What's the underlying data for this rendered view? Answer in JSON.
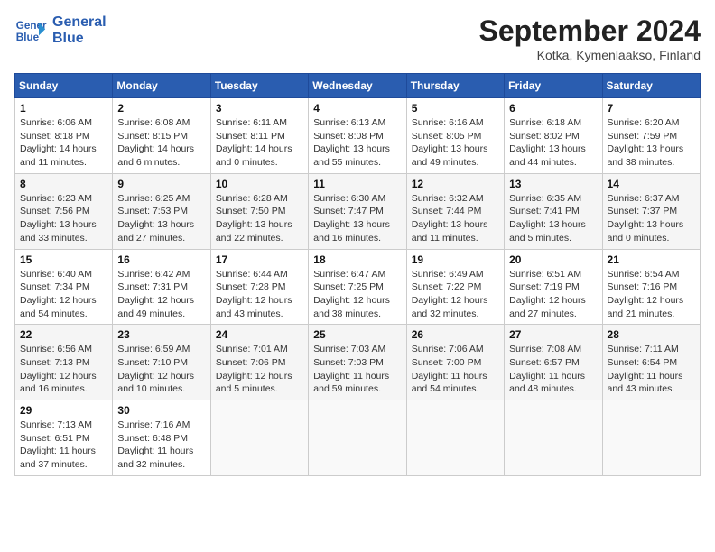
{
  "header": {
    "logo_line1": "General",
    "logo_line2": "Blue",
    "month_title": "September 2024",
    "location": "Kotka, Kymenlaakso, Finland"
  },
  "days_of_week": [
    "Sunday",
    "Monday",
    "Tuesday",
    "Wednesday",
    "Thursday",
    "Friday",
    "Saturday"
  ],
  "weeks": [
    [
      {
        "day": "1",
        "sunrise": "Sunrise: 6:06 AM",
        "sunset": "Sunset: 8:18 PM",
        "daylight": "Daylight: 14 hours and 11 minutes."
      },
      {
        "day": "2",
        "sunrise": "Sunrise: 6:08 AM",
        "sunset": "Sunset: 8:15 PM",
        "daylight": "Daylight: 14 hours and 6 minutes."
      },
      {
        "day": "3",
        "sunrise": "Sunrise: 6:11 AM",
        "sunset": "Sunset: 8:11 PM",
        "daylight": "Daylight: 14 hours and 0 minutes."
      },
      {
        "day": "4",
        "sunrise": "Sunrise: 6:13 AM",
        "sunset": "Sunset: 8:08 PM",
        "daylight": "Daylight: 13 hours and 55 minutes."
      },
      {
        "day": "5",
        "sunrise": "Sunrise: 6:16 AM",
        "sunset": "Sunset: 8:05 PM",
        "daylight": "Daylight: 13 hours and 49 minutes."
      },
      {
        "day": "6",
        "sunrise": "Sunrise: 6:18 AM",
        "sunset": "Sunset: 8:02 PM",
        "daylight": "Daylight: 13 hours and 44 minutes."
      },
      {
        "day": "7",
        "sunrise": "Sunrise: 6:20 AM",
        "sunset": "Sunset: 7:59 PM",
        "daylight": "Daylight: 13 hours and 38 minutes."
      }
    ],
    [
      {
        "day": "8",
        "sunrise": "Sunrise: 6:23 AM",
        "sunset": "Sunset: 7:56 PM",
        "daylight": "Daylight: 13 hours and 33 minutes."
      },
      {
        "day": "9",
        "sunrise": "Sunrise: 6:25 AM",
        "sunset": "Sunset: 7:53 PM",
        "daylight": "Daylight: 13 hours and 27 minutes."
      },
      {
        "day": "10",
        "sunrise": "Sunrise: 6:28 AM",
        "sunset": "Sunset: 7:50 PM",
        "daylight": "Daylight: 13 hours and 22 minutes."
      },
      {
        "day": "11",
        "sunrise": "Sunrise: 6:30 AM",
        "sunset": "Sunset: 7:47 PM",
        "daylight": "Daylight: 13 hours and 16 minutes."
      },
      {
        "day": "12",
        "sunrise": "Sunrise: 6:32 AM",
        "sunset": "Sunset: 7:44 PM",
        "daylight": "Daylight: 13 hours and 11 minutes."
      },
      {
        "day": "13",
        "sunrise": "Sunrise: 6:35 AM",
        "sunset": "Sunset: 7:41 PM",
        "daylight": "Daylight: 13 hours and 5 minutes."
      },
      {
        "day": "14",
        "sunrise": "Sunrise: 6:37 AM",
        "sunset": "Sunset: 7:37 PM",
        "daylight": "Daylight: 13 hours and 0 minutes."
      }
    ],
    [
      {
        "day": "15",
        "sunrise": "Sunrise: 6:40 AM",
        "sunset": "Sunset: 7:34 PM",
        "daylight": "Daylight: 12 hours and 54 minutes."
      },
      {
        "day": "16",
        "sunrise": "Sunrise: 6:42 AM",
        "sunset": "Sunset: 7:31 PM",
        "daylight": "Daylight: 12 hours and 49 minutes."
      },
      {
        "day": "17",
        "sunrise": "Sunrise: 6:44 AM",
        "sunset": "Sunset: 7:28 PM",
        "daylight": "Daylight: 12 hours and 43 minutes."
      },
      {
        "day": "18",
        "sunrise": "Sunrise: 6:47 AM",
        "sunset": "Sunset: 7:25 PM",
        "daylight": "Daylight: 12 hours and 38 minutes."
      },
      {
        "day": "19",
        "sunrise": "Sunrise: 6:49 AM",
        "sunset": "Sunset: 7:22 PM",
        "daylight": "Daylight: 12 hours and 32 minutes."
      },
      {
        "day": "20",
        "sunrise": "Sunrise: 6:51 AM",
        "sunset": "Sunset: 7:19 PM",
        "daylight": "Daylight: 12 hours and 27 minutes."
      },
      {
        "day": "21",
        "sunrise": "Sunrise: 6:54 AM",
        "sunset": "Sunset: 7:16 PM",
        "daylight": "Daylight: 12 hours and 21 minutes."
      }
    ],
    [
      {
        "day": "22",
        "sunrise": "Sunrise: 6:56 AM",
        "sunset": "Sunset: 7:13 PM",
        "daylight": "Daylight: 12 hours and 16 minutes."
      },
      {
        "day": "23",
        "sunrise": "Sunrise: 6:59 AM",
        "sunset": "Sunset: 7:10 PM",
        "daylight": "Daylight: 12 hours and 10 minutes."
      },
      {
        "day": "24",
        "sunrise": "Sunrise: 7:01 AM",
        "sunset": "Sunset: 7:06 PM",
        "daylight": "Daylight: 12 hours and 5 minutes."
      },
      {
        "day": "25",
        "sunrise": "Sunrise: 7:03 AM",
        "sunset": "Sunset: 7:03 PM",
        "daylight": "Daylight: 11 hours and 59 minutes."
      },
      {
        "day": "26",
        "sunrise": "Sunrise: 7:06 AM",
        "sunset": "Sunset: 7:00 PM",
        "daylight": "Daylight: 11 hours and 54 minutes."
      },
      {
        "day": "27",
        "sunrise": "Sunrise: 7:08 AM",
        "sunset": "Sunset: 6:57 PM",
        "daylight": "Daylight: 11 hours and 48 minutes."
      },
      {
        "day": "28",
        "sunrise": "Sunrise: 7:11 AM",
        "sunset": "Sunset: 6:54 PM",
        "daylight": "Daylight: 11 hours and 43 minutes."
      }
    ],
    [
      {
        "day": "29",
        "sunrise": "Sunrise: 7:13 AM",
        "sunset": "Sunset: 6:51 PM",
        "daylight": "Daylight: 11 hours and 37 minutes."
      },
      {
        "day": "30",
        "sunrise": "Sunrise: 7:16 AM",
        "sunset": "Sunset: 6:48 PM",
        "daylight": "Daylight: 11 hours and 32 minutes."
      },
      null,
      null,
      null,
      null,
      null
    ]
  ]
}
